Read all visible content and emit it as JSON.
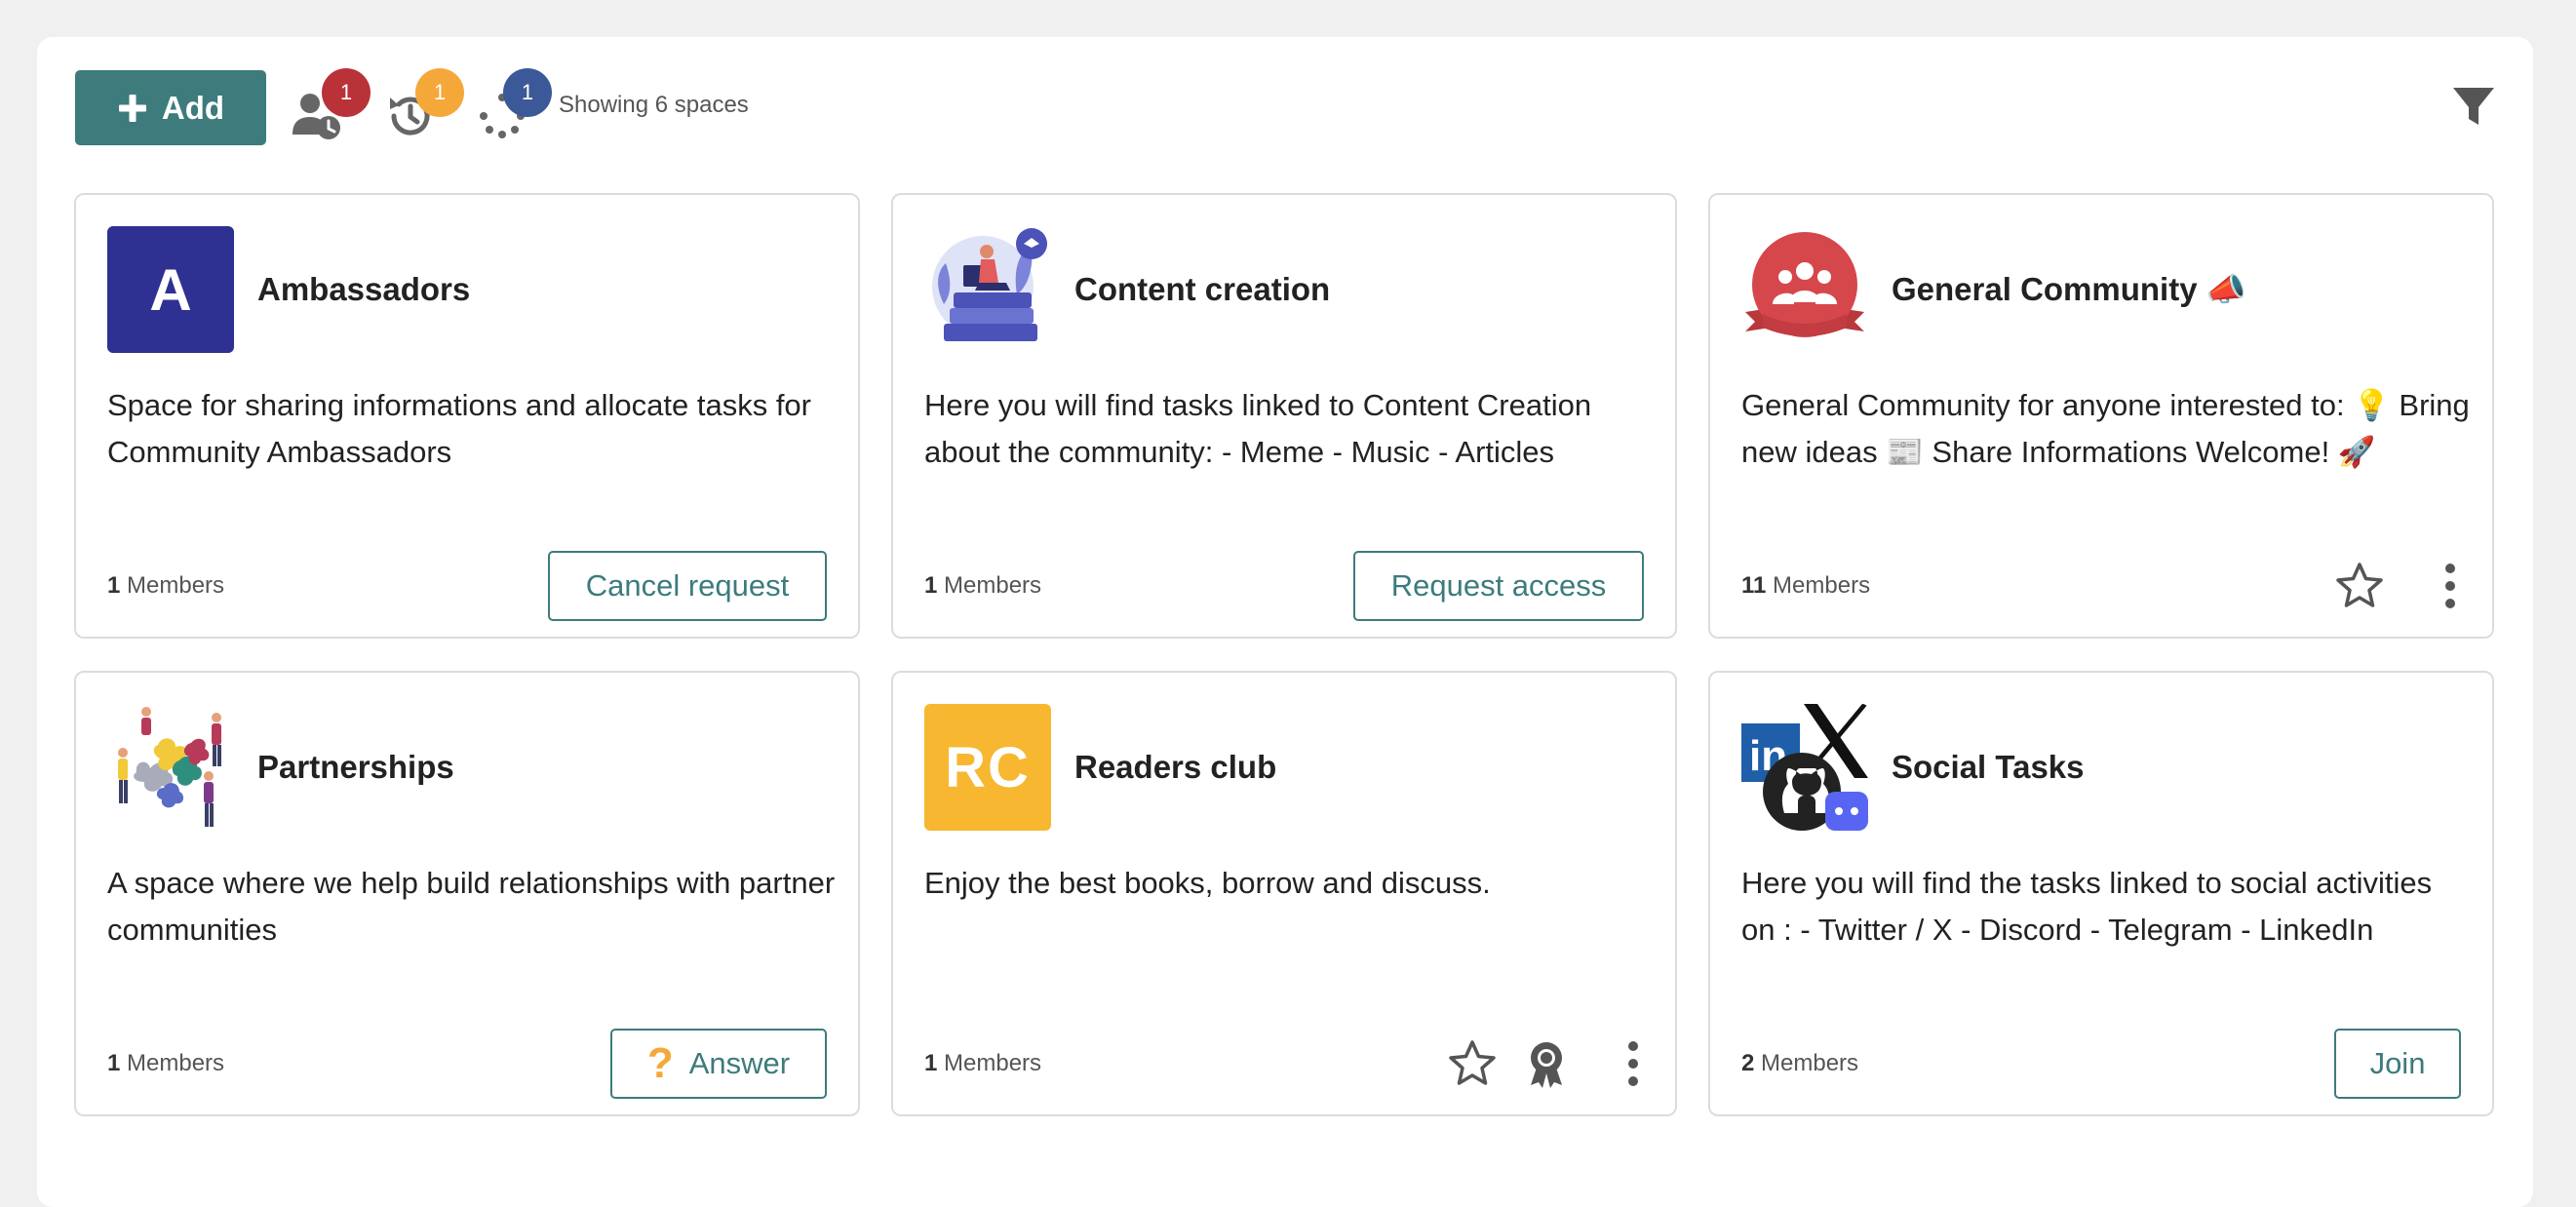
{
  "toolbar": {
    "add_label": "Add",
    "badges": {
      "pending_members": "1",
      "history": "1",
      "loading": "1"
    },
    "status_text": "Showing 6 spaces"
  },
  "colors": {
    "accent": "#3d7b7c",
    "badge_red": "#b83238",
    "badge_orange": "#f5a83a",
    "badge_blue": "#3b5998"
  },
  "cards": [
    {
      "title": "Ambassadors",
      "avatar_text": "A",
      "avatar_color": "#2e3192",
      "description": "Space for sharing informations and allocate tasks for Community Ambassadors",
      "members_count": "1",
      "members_label": " Members",
      "action_label": "Cancel request"
    },
    {
      "title": "Content creation",
      "description": "Here you will find tasks linked to Content Creation about the community:  - Meme  - Music  - Articles",
      "members_count": "1",
      "members_label": " Members",
      "action_label": "Request access"
    },
    {
      "title": "General Community 📣",
      "description": "General Community for anyone interested to:  💡 Bring new ideas  📰 Share Informations  Welcome! 🚀",
      "members_count": "11",
      "members_label": " Members"
    },
    {
      "title": "Partnerships",
      "description": "A space where we help build relationships with partner communities",
      "members_count": "1",
      "members_label": " Members",
      "action_label": "Answer"
    },
    {
      "title": "Readers club",
      "avatar_text": "RC",
      "avatar_color": "#f7b731",
      "description": "Enjoy the best books, borrow and discuss.",
      "members_count": "1",
      "members_label": " Members"
    },
    {
      "title": "Social Tasks",
      "description": "Here you will find the tasks linked to social activities on :  - Twitter / X  - Discord  - Telegram  - LinkedIn",
      "members_count": "2",
      "members_label": " Members",
      "action_label": "Join"
    }
  ]
}
